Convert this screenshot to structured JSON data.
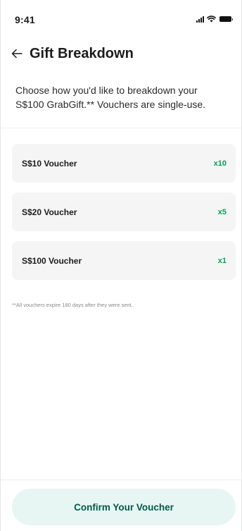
{
  "colors": {
    "accent": "#00A651",
    "card_background": "#F5F5F5",
    "button_background": "#E8F6F3",
    "button_text": "#005A4B"
  },
  "status_bar": {
    "time": "9:41",
    "icons": [
      "signal-icon",
      "wifi-icon",
      "battery-icon"
    ]
  },
  "header": {
    "back_icon": "arrow-left-icon",
    "title": "Gift Breakdown"
  },
  "description": "Choose how you'd like to breakdown your S$100 GrabGift.** Vouchers are single-use.",
  "vouchers": [
    {
      "label": "S$10 Voucher",
      "quantity": "x10"
    },
    {
      "label": "S$20 Voucher",
      "quantity": "x5"
    },
    {
      "label": "S$100 Voucher",
      "quantity": "x1"
    }
  ],
  "footnote": "**All vouchers expire 180 days after they were sent.",
  "confirm_button": {
    "label": "Confirm Your Voucher"
  }
}
